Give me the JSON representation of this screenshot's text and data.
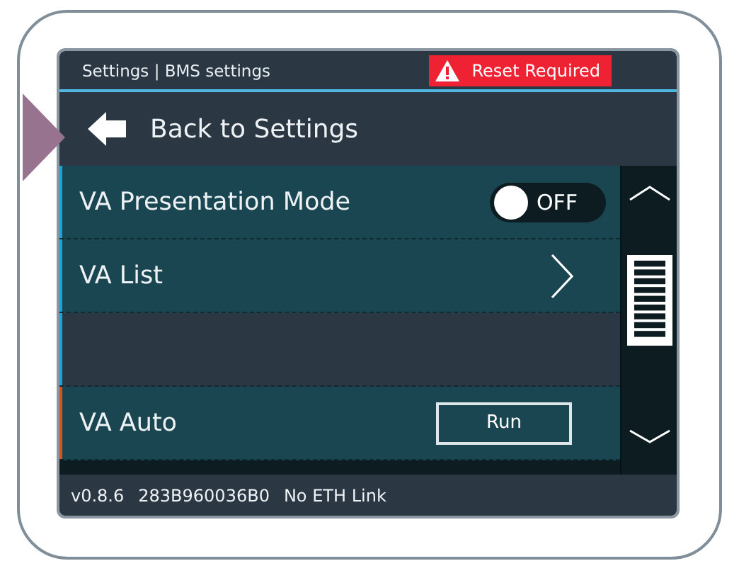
{
  "header": {
    "breadcrumb": "Settings | BMS settings",
    "alert": "Reset Required"
  },
  "back": {
    "label": "Back to Settings"
  },
  "rows": [
    {
      "kind": "toggle",
      "label": "VA Presentation Mode",
      "on": false,
      "state_text": "OFF",
      "color": "#1aa3d9"
    },
    {
      "kind": "link",
      "label": "VA List",
      "color": "#1aa3d9"
    },
    {
      "kind": "empty",
      "color": "#1aa3d9"
    },
    {
      "kind": "button",
      "label": "VA Auto",
      "button": "Run",
      "color": "#d9531a"
    }
  ],
  "status_bar": {
    "version": "v0.8.6",
    "serial": "283B960036B0",
    "network": "No ETH Link"
  }
}
